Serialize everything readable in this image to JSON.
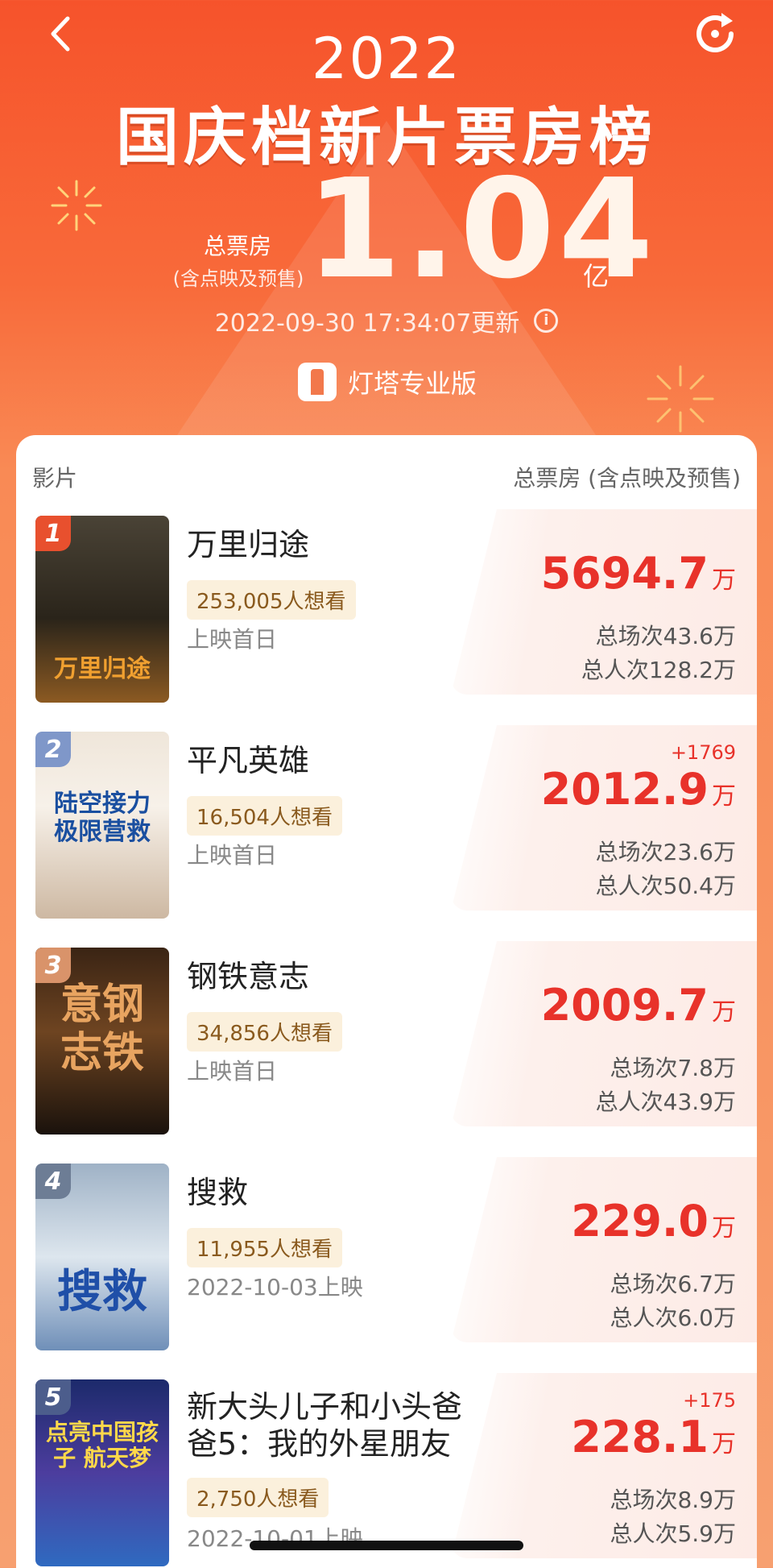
{
  "header": {
    "year": "2022",
    "title": "国庆档新片票房榜",
    "total_label": "总票房",
    "total_sub": "(含点映及预售)",
    "total_value": "1.04",
    "total_unit": "亿",
    "updated": "2022-09-30 17:34:07更新",
    "brand": "灯塔专业版"
  },
  "table": {
    "col_left": "影片",
    "col_right": "总票房 (含点映及预售)"
  },
  "movies": [
    {
      "rank": "1",
      "name": "万里归途",
      "want": "253,005人想看",
      "release": "上映首日",
      "gross": "5694.7",
      "unit": "万",
      "delta": "",
      "sessions": "总场次43.6万",
      "viewers": "总人次128.2万",
      "poster_title": "万里归途",
      "poster_colors": [
        "#3a3428",
        "#8c6a3a"
      ],
      "rank_color": "#e8502e"
    },
    {
      "rank": "2",
      "name": "平凡英雄",
      "want": "16,504人想看",
      "release": "上映首日",
      "gross": "2012.9",
      "unit": "万",
      "delta": "+1769",
      "sessions": "总场次23.6万",
      "viewers": "总人次50.4万",
      "poster_title": "陆空接力 极限营救",
      "poster_colors": [
        "#f4eee6",
        "#c9b8a6"
      ],
      "rank_color": "#7f97c9"
    },
    {
      "rank": "3",
      "name": "钢铁意志",
      "want": "34,856人想看",
      "release": "上映首日",
      "gross": "2009.7",
      "unit": "万",
      "delta": "",
      "sessions": "总场次7.8万",
      "viewers": "总人次43.9万",
      "poster_title": "意钢 志铁",
      "poster_colors": [
        "#2a1c12",
        "#7a4a22"
      ],
      "rank_color": "#d9936a"
    },
    {
      "rank": "4",
      "name": "搜救",
      "want": "11,955人想看",
      "release": "2022-10-03上映",
      "gross": "229.0",
      "unit": "万",
      "delta": "",
      "sessions": "总场次6.7万",
      "viewers": "总人次6.0万",
      "poster_title": "搜救",
      "poster_colors": [
        "#b8c8d8",
        "#4f6f98"
      ],
      "rank_color": "#6d7d95"
    },
    {
      "rank": "5",
      "name": "新大头儿子和小头爸爸5：我的外星朋友",
      "name_line1": "新大头儿子和小头爸",
      "name_line2": "爸5：我的外星朋友",
      "want": "2,750人想看",
      "release": "2022-10-01上映",
      "gross": "228.1",
      "unit": "万",
      "delta": "+175",
      "sessions": "总场次8.9万",
      "viewers": "总人次5.9万",
      "poster_title": "点亮中国孩子 航天梦",
      "poster_colors": [
        "#2b3d8f",
        "#6e4fb8"
      ],
      "rank_color": "#4c5d8c"
    }
  ]
}
